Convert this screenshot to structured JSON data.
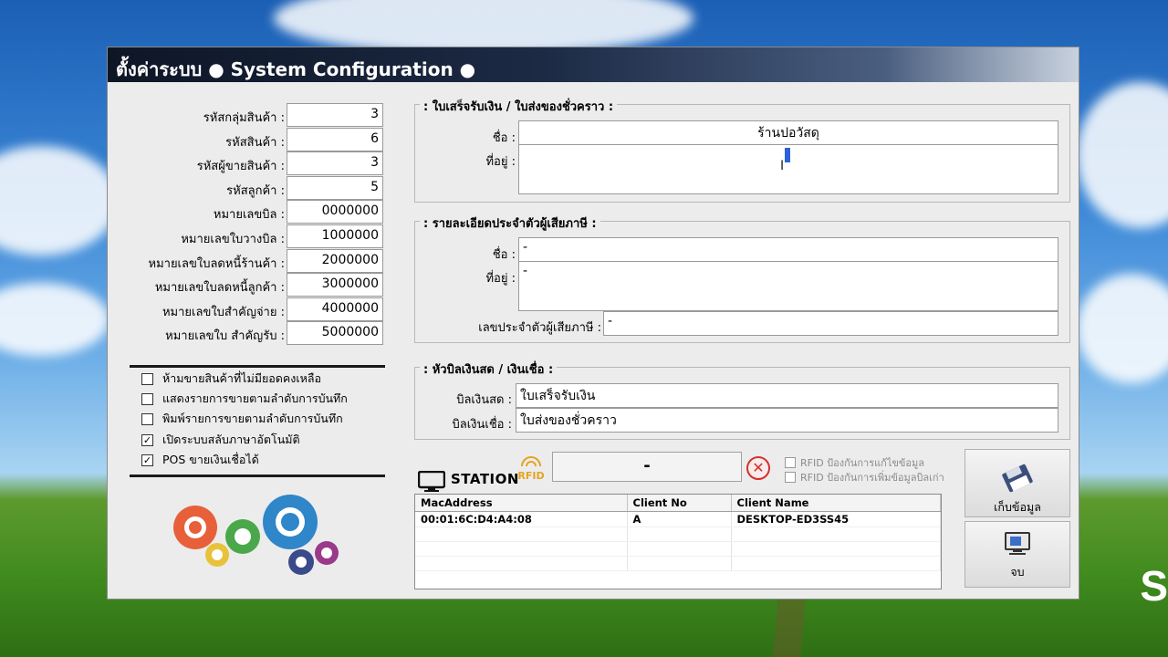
{
  "window": {
    "title": "ตั้งค่าระบบ ● System Configuration ●"
  },
  "left_fields": [
    {
      "label": "รหัสกลุ่มสินค้า :",
      "value": "3"
    },
    {
      "label": "รหัสสินค้า :",
      "value": "6"
    },
    {
      "label": "รหัสผู้ขายสินค้า :",
      "value": "3"
    },
    {
      "label": "รหัสลูกค้า :",
      "value": "5"
    },
    {
      "label": "หมายเลขบิล :",
      "value": "0000000"
    },
    {
      "label": "หมายเลขใบวางบิล :",
      "value": "1000000"
    },
    {
      "label": "หมายเลขใบลดหนี้ร้านค้า :",
      "value": "2000000"
    },
    {
      "label": "หมายเลขใบลดหนี้ลูกค้า :",
      "value": "3000000"
    },
    {
      "label": "หมายเลขใบสำคัญจ่าย :",
      "value": "4000000"
    },
    {
      "label": "หมายเลขใบ สำคัญรับ :",
      "value": "5000000"
    }
  ],
  "options": [
    {
      "label": "ห้ามขายสินค้าที่ไม่มียอดคงเหลือ",
      "checked": false
    },
    {
      "label": "แสดงรายการขายตามลำดับการบันทึก",
      "checked": false
    },
    {
      "label": "พิมพ์รายการขายตามลำดับการบันทึก",
      "checked": false
    },
    {
      "label": "เปิดระบบสลับภาษาอัตโนมัติ",
      "checked": true
    },
    {
      "label": "POS ขายเงินเชื่อได้",
      "checked": true
    }
  ],
  "receipt_group": {
    "title": ": ใบเสร็จรับเงิน / ใบส่งของชั่วคราว :",
    "name_label": "ชื่อ :",
    "name_value": "ร้านปอวัสดุ",
    "address_label": "ที่อยู่ :",
    "address_value": ""
  },
  "taxpayer_group": {
    "title": ": รายละเอียดประจำตัวผู้เสียภาษี :",
    "name_label": "ชื่อ :",
    "name_value": "-",
    "address_label": "ที่อยู่ :",
    "address_value": "-",
    "taxid_label": "เลขประจำตัวผู้เสียภาษี :",
    "taxid_value": "-"
  },
  "bill_header_group": {
    "title": ": หัวบิลเงินสด / เงินเชื่อ :",
    "cash_label": "บิลเงินสด :",
    "cash_value": "ใบเสร็จรับเงิน",
    "credit_label": "บิลเงินเชื่อ :",
    "credit_value": "ใบส่งของชั่วคราว"
  },
  "station": {
    "label": "STATION",
    "rfid_text": "RFID",
    "status_value": "-",
    "rfid_options": [
      {
        "label": "RFID ป้องกันการแก้ไขข้อมูล",
        "checked": false
      },
      {
        "label": "RFID ป้องกันการเพิ่มข้อมูลบิลเก่า",
        "checked": false
      }
    ],
    "table": {
      "columns": [
        "MacAddress",
        "Client No",
        "Client Name"
      ],
      "rows": [
        [
          "00:01:6C:D4:A4:08",
          "A",
          "DESKTOP-ED3SS45"
        ]
      ]
    }
  },
  "buttons": {
    "save_label": "เก็บข้อมูล",
    "exit_label": "จบ"
  },
  "icons": {
    "save": "floppy-disk-icon",
    "exit": "monitor-exit-icon",
    "station": "monitor-icon",
    "rfid": "rfid-icon",
    "clear": "close-circle-icon",
    "gears": "gears-icon"
  },
  "colors": {
    "titlebar": "#0e1626",
    "close": "#d23030",
    "rfid": "#e5a321"
  }
}
